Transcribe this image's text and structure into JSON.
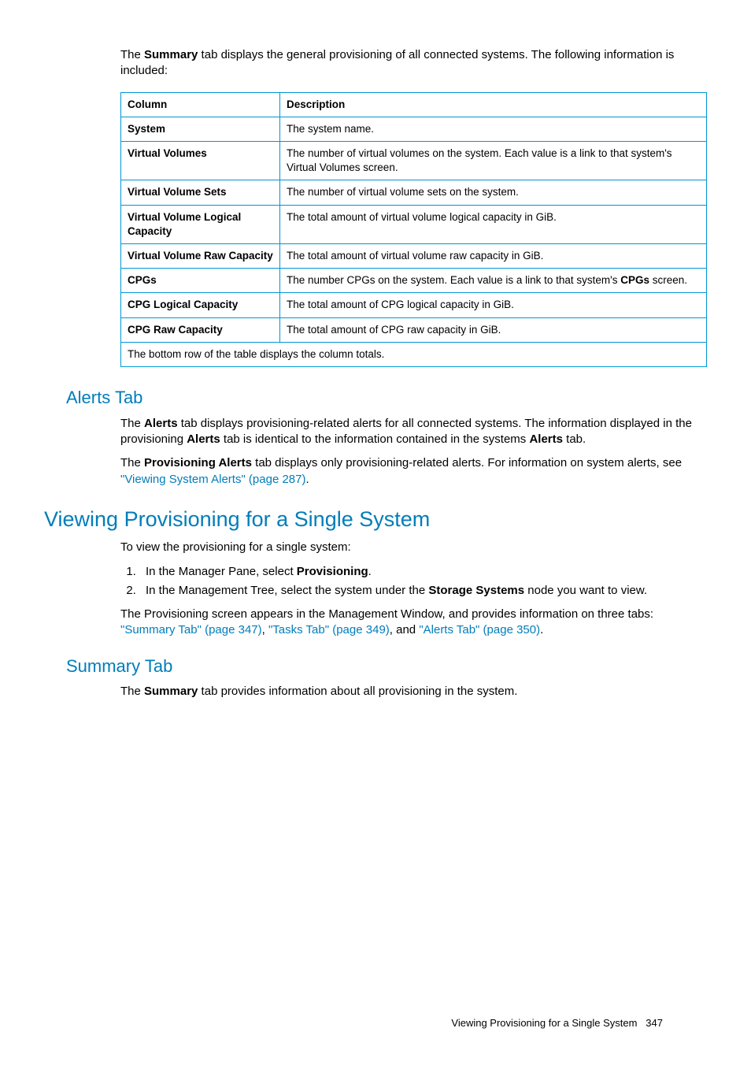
{
  "intro": {
    "prefix": "The ",
    "bold": "Summary",
    "suffix": " tab displays the general provisioning of all connected systems. The following information is included:"
  },
  "table": {
    "head": {
      "c1": "Column",
      "c2": "Description"
    },
    "rows": [
      {
        "name": "System",
        "desc": "The system name."
      },
      {
        "name": "Virtual Volumes",
        "desc": "The number of virtual volumes on the system. Each value is a link to that system's Virtual Volumes screen."
      },
      {
        "name": "Virtual Volume Sets",
        "desc": "The number of virtual volume sets on the system."
      },
      {
        "name": "Virtual Volume Logical Capacity",
        "desc": "The total amount of virtual volume logical capacity in GiB."
      },
      {
        "name": "Virtual Volume Raw Capacity",
        "desc": "The total amount of virtual volume raw capacity in GiB."
      },
      {
        "name": "CPGs",
        "desc_pre": "The number CPGs on the system. Each value is a link to that system's ",
        "desc_bold": "CPGs",
        "desc_post": " screen."
      },
      {
        "name": "CPG Logical Capacity",
        "desc": "The total amount of CPG logical capacity in GiB."
      },
      {
        "name": "CPG Raw Capacity",
        "desc": "The total amount of CPG raw capacity in GiB."
      }
    ],
    "footer": "The bottom row of the table displays the column totals."
  },
  "alerts": {
    "heading": "Alerts Tab",
    "p1": {
      "t1": "The ",
      "b1": "Alerts",
      "t2": " tab displays provisioning-related alerts for all connected systems. The information displayed in the provisioning ",
      "b2": "Alerts",
      "t3": " tab is identical to the information contained in the systems ",
      "b3": "Alerts",
      "t4": " tab."
    },
    "p2": {
      "t1": "The ",
      "b1": "Provisioning Alerts",
      "t2": " tab displays only provisioning-related alerts. For information on system alerts, see ",
      "link": "\"Viewing System Alerts\" (page 287)",
      "t3": "."
    }
  },
  "viewing": {
    "heading": "Viewing Provisioning for a Single System",
    "intro": "To view the provisioning for a single system:",
    "steps": [
      {
        "t1": "In the Manager Pane, select ",
        "b1": "Provisioning",
        "t2": "."
      },
      {
        "t1": "In the Management Tree, select the system under the ",
        "b1": "Storage Systems",
        "t2": " node you want to view."
      }
    ],
    "p3": {
      "t1": "The Provisioning screen appears in the Management Window, and provides information on three tabs: ",
      "l1": "\"Summary Tab\" (page 347)",
      "sep1": ", ",
      "l2": "\"Tasks Tab\" (page 349)",
      "sep2": ", and ",
      "l3": "\"Alerts Tab\" (page 350)",
      "t2": "."
    }
  },
  "summary2": {
    "heading": "Summary Tab",
    "p": {
      "t1": "The ",
      "b1": "Summary",
      "t2": " tab provides information about all provisioning in the system."
    }
  },
  "footer": {
    "title": "Viewing Provisioning for a Single System",
    "page": "347"
  }
}
